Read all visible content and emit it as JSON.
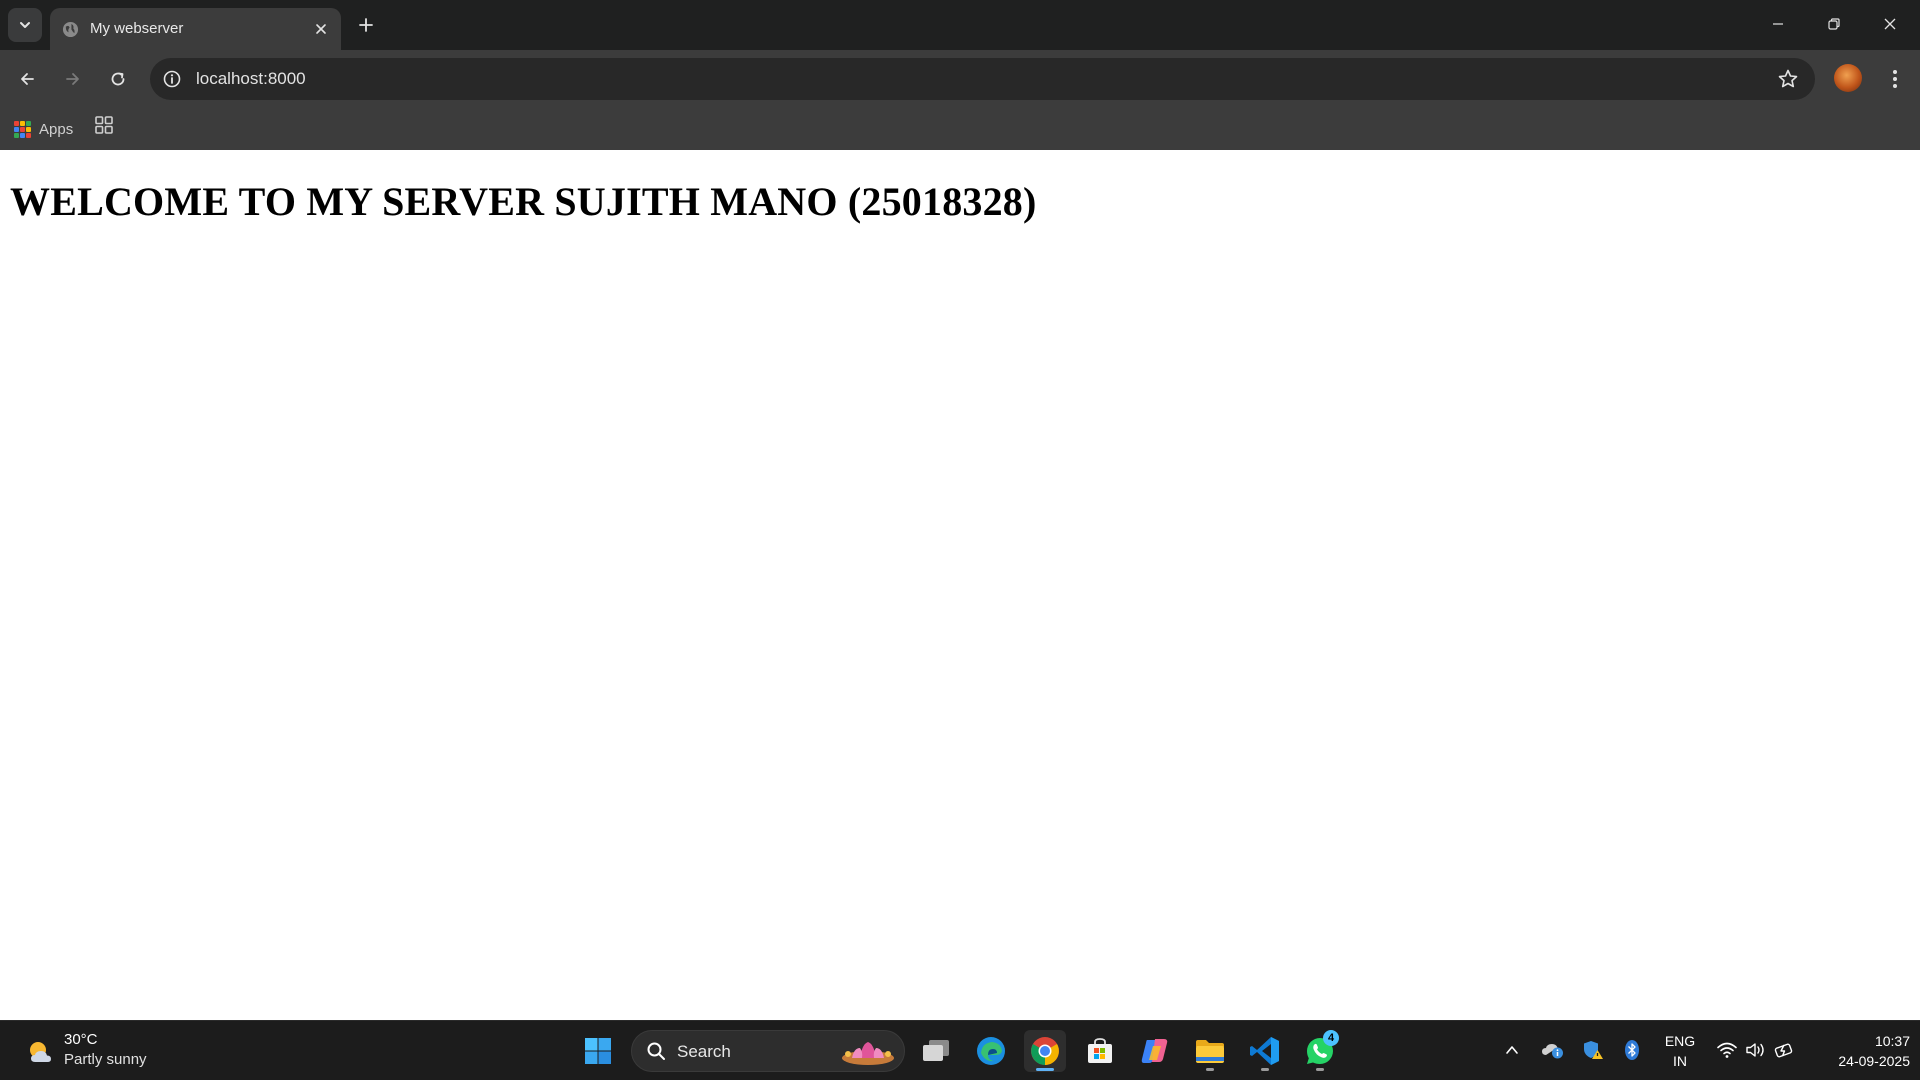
{
  "browser": {
    "tab": {
      "title": "My webserver"
    },
    "address_bar": {
      "url": "localhost:8000"
    },
    "bookmarks": {
      "apps_label": "Apps"
    }
  },
  "page": {
    "heading": "WELCOME TO MY SERVER SUJITH MANO (25018328)"
  },
  "taskbar": {
    "weather": {
      "temperature": "30°C",
      "condition": "Partly sunny"
    },
    "search": {
      "label": "Search"
    },
    "pinned_apps": [
      "task-view",
      "edge",
      "chrome",
      "microsoft-store",
      "copilot",
      "file-explorer",
      "vscode",
      "whatsapp"
    ],
    "whatsapp_badge": "4",
    "language": {
      "line1": "ENG",
      "line2": "IN"
    },
    "clock": {
      "time": "10:37",
      "date": "24-09-2025"
    }
  },
  "colors": {
    "tabstrip": "#1f2020",
    "toolbar": "#3c3c3c",
    "omnibox": "#282828",
    "taskbar": "#1c1c1c",
    "accent": "#5fb2f5"
  }
}
